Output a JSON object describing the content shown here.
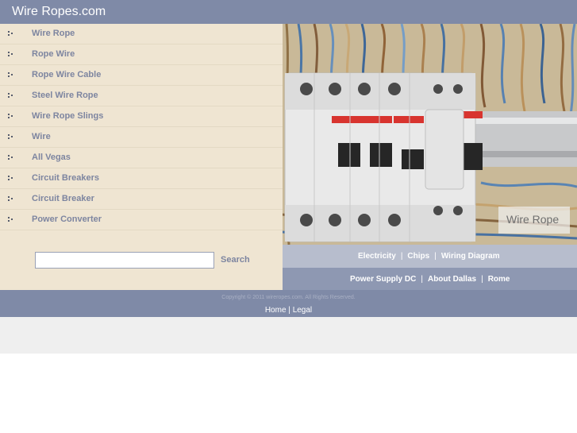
{
  "header": {
    "title": "Wire Ropes.com"
  },
  "sidebar": {
    "items": [
      {
        "label": "Wire Rope"
      },
      {
        "label": "Rope Wire"
      },
      {
        "label": "Rope Wire Cable"
      },
      {
        "label": "Steel Wire Rope"
      },
      {
        "label": "Wire Rope Slings"
      },
      {
        "label": "Wire"
      },
      {
        "label": "All Vegas"
      },
      {
        "label": "Circuit Breakers"
      },
      {
        "label": "Circuit Breaker"
      },
      {
        "label": "Power Converter"
      }
    ]
  },
  "search": {
    "value": "",
    "button_label": "Search"
  },
  "hero": {
    "caption": "Wire Rope"
  },
  "links_row1": [
    "Electricity",
    "Chips",
    "Wiring Diagram"
  ],
  "links_row2": [
    "Power Supply DC",
    "About Dallas",
    "Rome"
  ],
  "footer": {
    "copyright": "Copyright © 2011 wireropes.com. All Rights Reserved.",
    "home_label": "Home",
    "separator": "|",
    "legal_label": "Legal"
  },
  "colors": {
    "header_bg": "#7f8aa7",
    "sidebar_bg": "#efe5d2",
    "nav_text": "#7d85a0",
    "linkbar_light": "#b7bdcd",
    "linkbar_dark": "#8e98b2"
  }
}
